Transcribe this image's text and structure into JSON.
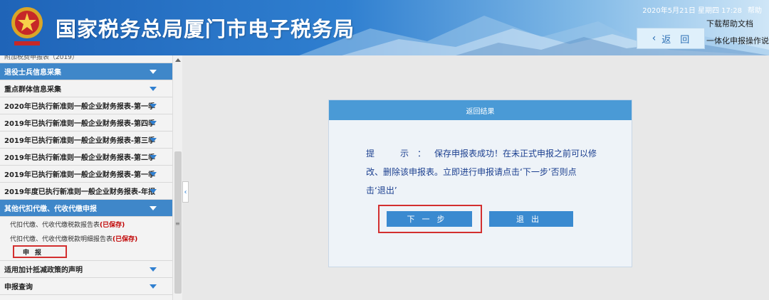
{
  "header": {
    "title": "国家税务总局厦门市电子税务局",
    "datetime": "2020年5月21日 星期四 17:28",
    "help": "帮助",
    "download_help": "下载帮助文档",
    "back": "返　回",
    "guide": "一体化申报操作说"
  },
  "sidebar": {
    "top_partial": "附加税费申报表（2019）",
    "items": [
      {
        "label": "退役士兵信息采集",
        "active": true
      },
      {
        "label": "重点群体信息采集"
      },
      {
        "label": "2020年已执行新准则一般企业财务报表-第一季"
      },
      {
        "label": "2019年已执行新准则一般企业财务报表-第四季"
      },
      {
        "label": "2019年已执行新准则一般企业财务报表-第三季"
      },
      {
        "label": "2019年已执行新准则一般企业财务报表-第二季"
      },
      {
        "label": "2019年已执行新准则一般企业财务报表-第一季"
      },
      {
        "label": "2019年度已执行新准则一般企业财务报表-年报"
      }
    ],
    "group": {
      "label": "其他代扣代缴、代收代缴申报",
      "subs": [
        {
          "label": "代扣代缴、代收代缴税款报告表",
          "status": "(已保存)"
        },
        {
          "label": "代扣代缴、代收代缴税款明细报告表",
          "status": "(已保存)"
        }
      ],
      "declare": "申报"
    },
    "bottom_items": [
      {
        "label": "适用加计抵减政策的声明"
      },
      {
        "label": "申报查询"
      }
    ]
  },
  "dialog": {
    "title": "返回结果",
    "label": "提　示：",
    "message_1": "保存申报表成功！在未正式申报之前可以修",
    "message_2": "改、删除该申报表。立即进行申报请点击‘下一步’否则点",
    "message_3": "击‘退出’",
    "next": "下一步",
    "exit": "退出"
  },
  "colors": {
    "brand_blue": "#3f87c9",
    "header_blue": "#1f64b8",
    "highlight_red": "#d32f2f",
    "saved_red": "#c00000"
  }
}
